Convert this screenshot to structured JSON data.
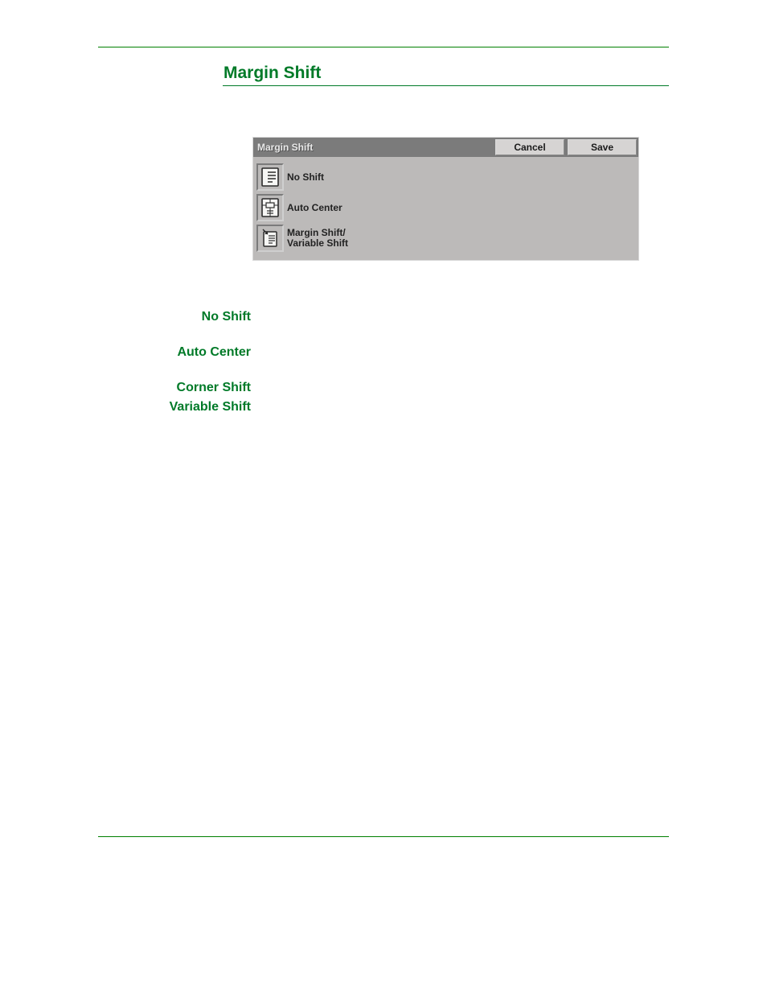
{
  "section": {
    "title": "Margin Shift"
  },
  "dialog": {
    "title": "Margin Shift",
    "cancel": "Cancel",
    "save": "Save",
    "options": {
      "no_shift": "No Shift",
      "auto_center": "Auto Center",
      "margin_variable": "Margin Shift/\nVariable Shift"
    }
  },
  "terms": {
    "no_shift": {
      "label": "No Shift"
    },
    "auto_center": {
      "label": "Auto Center"
    },
    "corner_shift": {
      "label": "Corner Shift"
    },
    "variable_shift": {
      "label": "Variable Shift"
    }
  }
}
